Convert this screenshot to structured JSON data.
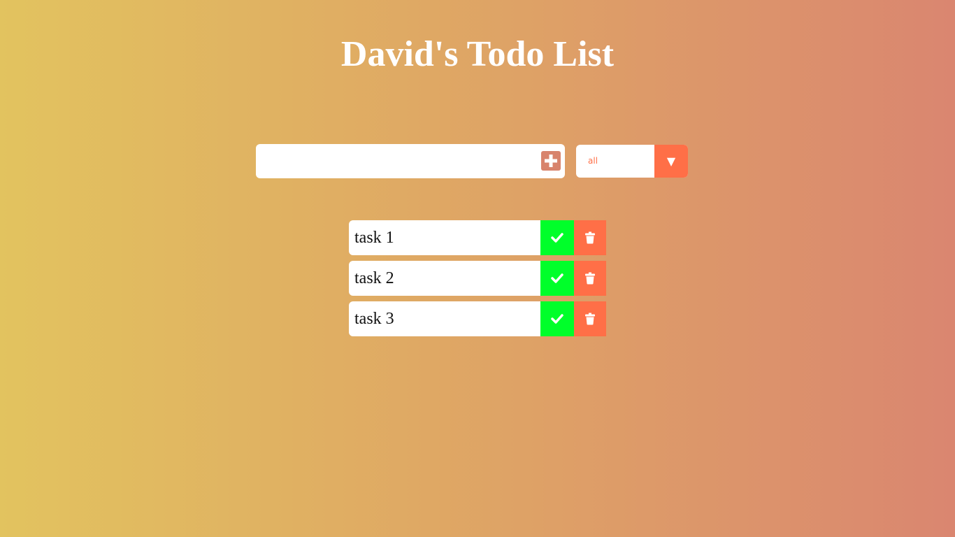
{
  "header": {
    "title": "David's Todo List"
  },
  "todo_form": {
    "input_value": "",
    "add_icon": "plus-square-icon",
    "filter": {
      "selected": "all",
      "arrow_glyph": "▼"
    }
  },
  "todos": [
    {
      "text": "task 1"
    },
    {
      "text": "task 2"
    },
    {
      "text": "task 3"
    }
  ],
  "icons": {
    "complete": "check-icon",
    "delete": "trash-icon"
  },
  "colors": {
    "gradient_start": "#e2c35f",
    "gradient_end": "#da8670",
    "accent": "#ff6f47",
    "add_button": "#d8846d",
    "complete": "#00ff2a",
    "text_on_accent": "#ffffff"
  }
}
